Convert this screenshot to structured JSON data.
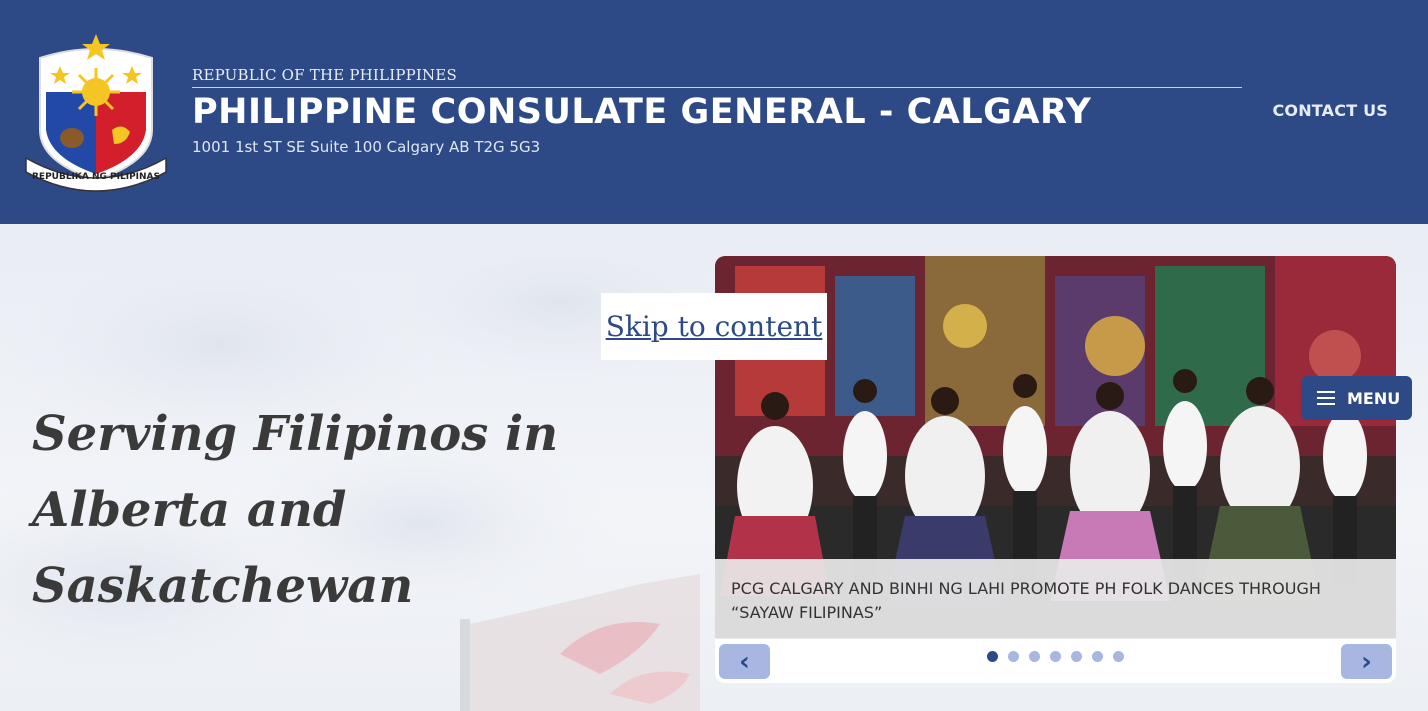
{
  "header": {
    "republic": "REPUBLIC OF THE PHILIPPINES",
    "title": "PHILIPPINE CONSULATE GENERAL - CALGARY",
    "address": "1001 1st ST SE Suite 100 Calgary AB T2G 5G3",
    "contact_label": "CONTACT US",
    "seal_text": "REPUBLIKA NG PILIPINAS"
  },
  "skip_link": "Skip to content",
  "hero": {
    "tagline": "Serving Filipinos in Alberta and Saskatchewan"
  },
  "carousel": {
    "caption": "PCG CALGARY AND BINHI NG LAHI PROMOTE PH FOLK DANCES THROUGH “SAYAW FILIPINAS”",
    "prev_label": "‹",
    "next_label": "›",
    "slide_count": 7,
    "active_index": 0
  },
  "menu": {
    "label": "MENU",
    "icon": "hamburger-icon"
  },
  "colors": {
    "primary": "#2d4a86",
    "accent_light": "#a7b7e2",
    "caption_bg": "#e8e8e8"
  }
}
